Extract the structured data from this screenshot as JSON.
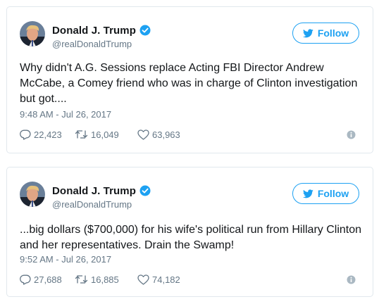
{
  "colors": {
    "accent": "#1da1f2",
    "text": "#14171a",
    "secondary": "#657786",
    "border": "#e1e8ed",
    "info_icon": "#aab8c2"
  },
  "tweets": [
    {
      "author": {
        "display_name": "Donald J. Trump",
        "handle": "@realDonaldTrump",
        "verified_icon": "verified-badge-icon"
      },
      "follow_label": "Follow",
      "text": "Why didn't A.G. Sessions replace Acting FBI Director Andrew McCabe, a Comey friend who was in charge of Clinton investigation but got....",
      "timestamp": "9:48 AM - Jul 26, 2017",
      "replies": "22,423",
      "retweets": "16,049",
      "likes": "63,963"
    },
    {
      "author": {
        "display_name": "Donald J. Trump",
        "handle": "@realDonaldTrump",
        "verified_icon": "verified-badge-icon"
      },
      "follow_label": "Follow",
      "text": "...big dollars ($700,000) for his wife's political run from Hillary Clinton and her representatives. Drain the Swamp!",
      "timestamp": "9:52 AM - Jul 26, 2017",
      "replies": "27,688",
      "retweets": "16,885",
      "likes": "74,182"
    }
  ]
}
